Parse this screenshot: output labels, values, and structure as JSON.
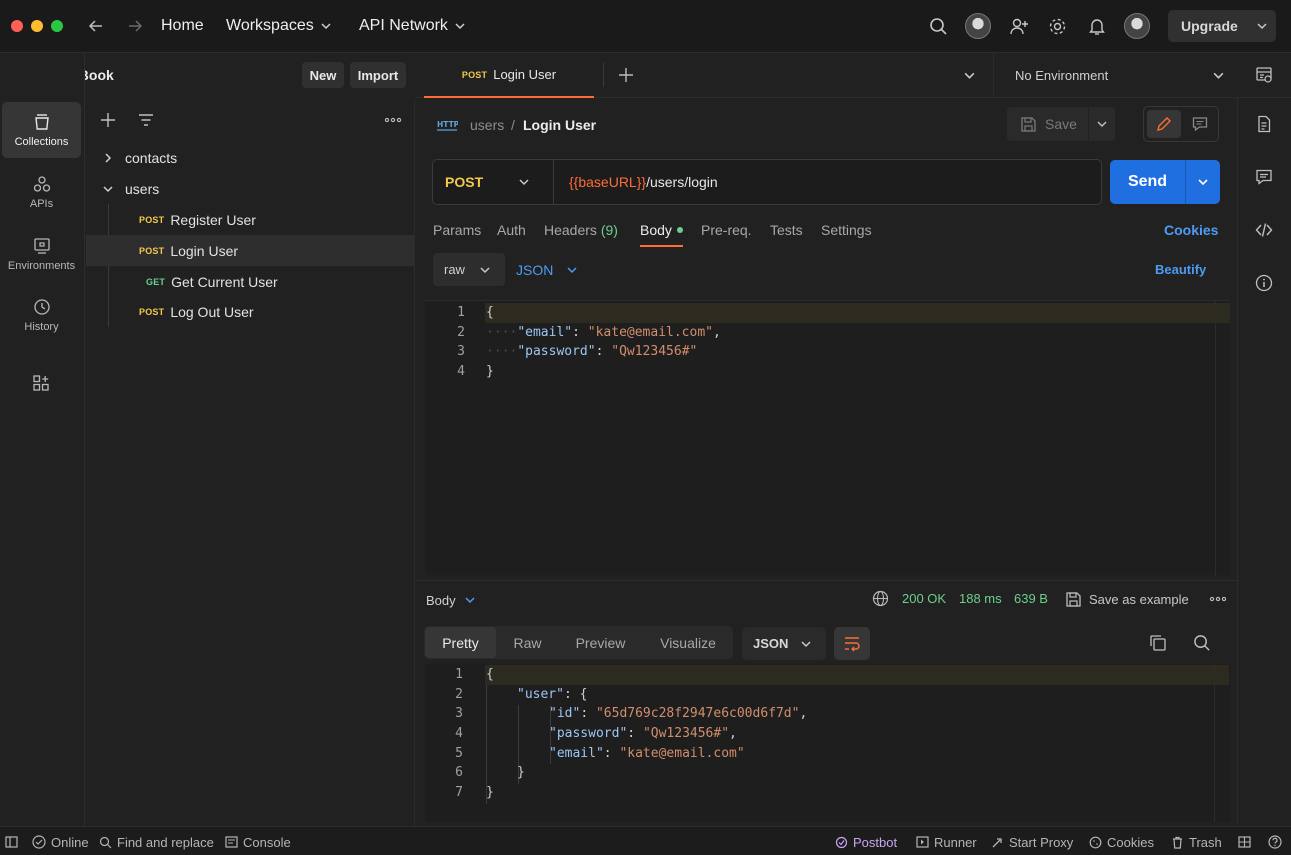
{
  "titlebar": {
    "nav": {
      "home": "Home",
      "workspaces": "Workspaces",
      "api_network": "API Network"
    },
    "upgrade": "Upgrade"
  },
  "workspace": {
    "name": "PhoneBook",
    "new": "New",
    "import": "Import"
  },
  "rail": [
    {
      "label": "Collections",
      "icon": "collections-icon"
    },
    {
      "label": "APIs",
      "icon": "apis-icon"
    },
    {
      "label": "Environments",
      "icon": "environments-icon"
    },
    {
      "label": "History",
      "icon": "history-icon"
    }
  ],
  "tree": {
    "folders": [
      "contacts",
      "users"
    ],
    "requests": [
      {
        "method": "POST",
        "name": "Register User"
      },
      {
        "method": "POST",
        "name": "Login User"
      },
      {
        "method": "GET",
        "name": "Get Current User"
      },
      {
        "method": "POST",
        "name": "Log Out User"
      }
    ]
  },
  "tab": {
    "method": "POST",
    "name": "Login User"
  },
  "environment": "No Environment",
  "request": {
    "breadcrumb_parent": "users",
    "breadcrumb_sep": "/",
    "breadcrumb_current": "Login User",
    "save": "Save",
    "method": "POST",
    "url_var": "{{baseURL}}",
    "url_path": "/users/login",
    "send": "Send",
    "tabs": {
      "params": "Params",
      "auth": "Auth",
      "headers": "Headers",
      "headers_count": "(9)",
      "body": "Body",
      "prereq": "Pre-req.",
      "tests": "Tests",
      "settings": "Settings"
    },
    "cookies": "Cookies",
    "body_mode": "raw",
    "body_lang": "JSON",
    "beautify": "Beautify",
    "body_lines": [
      {
        "n": "1",
        "text": "{"
      },
      {
        "n": "2",
        "key": "\"email\"",
        "value": "\"kate@email.com\""
      },
      {
        "n": "3",
        "key": "\"password\"",
        "value": "\"Qw123456#\""
      },
      {
        "n": "4",
        "text": "}"
      }
    ]
  },
  "response": {
    "label": "Body",
    "status": "200 OK",
    "time": "188 ms",
    "size": "639 B",
    "save_example": "Save as example",
    "views": [
      "Pretty",
      "Raw",
      "Preview",
      "Visualize"
    ],
    "format": "JSON",
    "lines": [
      {
        "n": "1",
        "text": "{"
      },
      {
        "n": "2",
        "key": "\"user\"",
        "tail": ": {"
      },
      {
        "n": "3",
        "key": "\"id\"",
        "value": "\"65d769c28f2947e6c00d6f7d\"",
        "comma": ","
      },
      {
        "n": "4",
        "key": "\"password\"",
        "value": "\"Qw123456#\"",
        "comma": ","
      },
      {
        "n": "5",
        "key": "\"email\"",
        "value": "\"kate@email.com\"",
        "comma": ""
      },
      {
        "n": "6",
        "text": "}"
      },
      {
        "n": "7",
        "text": "}"
      }
    ]
  },
  "statusbar": {
    "online": "Online",
    "find": "Find and replace",
    "console": "Console",
    "postbot": "Postbot",
    "runner": "Runner",
    "proxy": "Start Proxy",
    "cookies": "Cookies",
    "trash": "Trash"
  },
  "colors": {
    "accent": "#ff6c37",
    "send": "#1f6fe0",
    "post": "#f2c94c",
    "get": "#6ccf8e",
    "status_ok": "#6ccf8e",
    "link": "#4d9cf5"
  }
}
